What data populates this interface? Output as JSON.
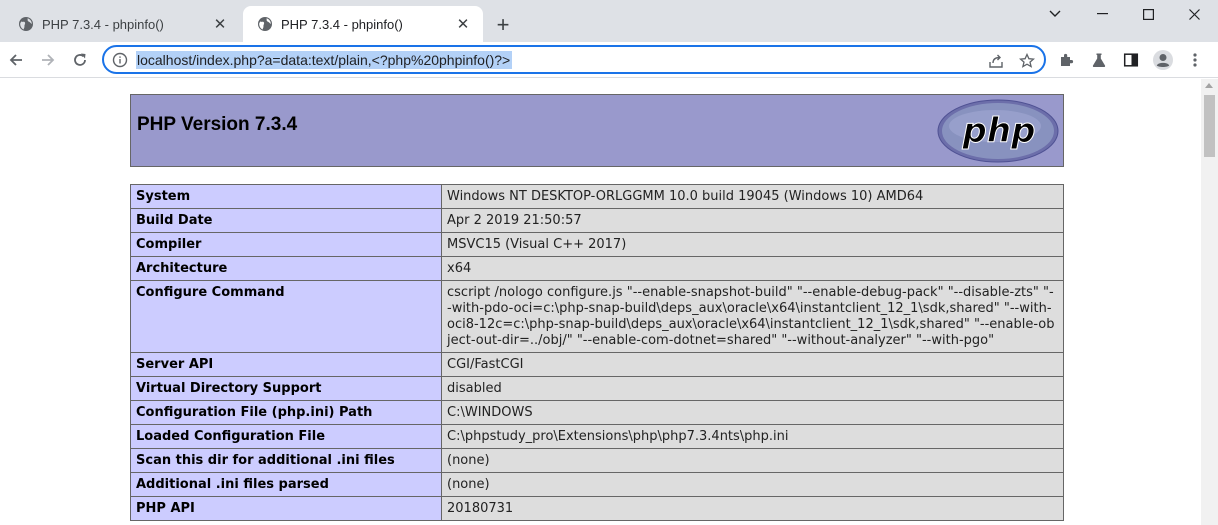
{
  "browser": {
    "tabs": [
      {
        "title": "PHP 7.3.4 - phpinfo()",
        "active": false
      },
      {
        "title": "PHP 7.3.4 - phpinfo()",
        "active": true
      }
    ],
    "url": "localhost/index.php?a=data:text/plain,<?php%20phpinfo()?>",
    "window_controls": [
      "chevron-down-icon",
      "minimize-icon",
      "maximize-icon",
      "close-icon"
    ],
    "accent_color": "#1a73e8"
  },
  "page": {
    "header": {
      "title": "PHP Version 7.3.4",
      "logo_text": "php"
    },
    "colors": {
      "header_bg": "#9999cc",
      "key_bg": "#ccccff",
      "value_bg": "#dddddd"
    },
    "rows": [
      {
        "key": "System",
        "value": "Windows NT DESKTOP-ORLGGMM 10.0 build 19045 (Windows 10) AMD64"
      },
      {
        "key": "Build Date",
        "value": "Apr 2 2019 21:50:57"
      },
      {
        "key": "Compiler",
        "value": "MSVC15 (Visual C++ 2017)"
      },
      {
        "key": "Architecture",
        "value": "x64"
      },
      {
        "key": "Configure Command",
        "value": "cscript /nologo configure.js \"--enable-snapshot-build\" \"--enable-debug-pack\" \"--disable-zts\" \"--with-pdo-oci=c:\\php-snap-build\\deps_aux\\oracle\\x64\\instantclient_12_1\\sdk,shared\" \"--with-oci8-12c=c:\\php-snap-build\\deps_aux\\oracle\\x64\\instantclient_12_1\\sdk,shared\" \"--enable-object-out-dir=../obj/\" \"--enable-com-dotnet=shared\" \"--without-analyzer\" \"--with-pgo\""
      },
      {
        "key": "Server API",
        "value": "CGI/FastCGI"
      },
      {
        "key": "Virtual Directory Support",
        "value": "disabled"
      },
      {
        "key": "Configuration File (php.ini) Path",
        "value": "C:\\WINDOWS"
      },
      {
        "key": "Loaded Configuration File",
        "value": "C:\\phpstudy_pro\\Extensions\\php\\php7.3.4nts\\php.ini"
      },
      {
        "key": "Scan this dir for additional .ini files",
        "value": "(none)"
      },
      {
        "key": "Additional .ini files parsed",
        "value": "(none)"
      },
      {
        "key": "PHP API",
        "value": "20180731"
      }
    ]
  }
}
